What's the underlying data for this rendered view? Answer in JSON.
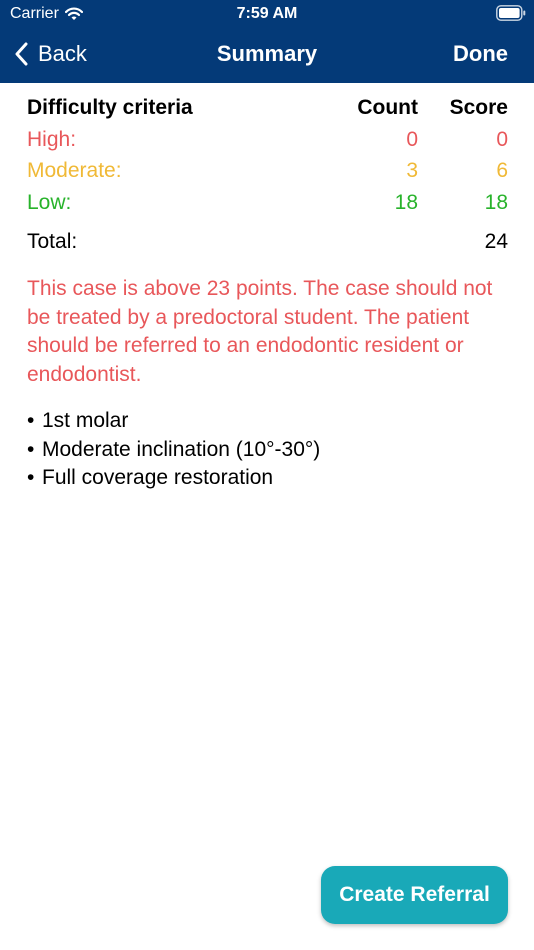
{
  "status_bar": {
    "carrier": "Carrier",
    "time": "7:59 AM"
  },
  "nav": {
    "back_label": "Back",
    "title": "Summary",
    "done_label": "Done"
  },
  "table": {
    "headers": {
      "criteria": "Difficulty criteria",
      "count": "Count",
      "score": "Score"
    },
    "rows": [
      {
        "label": "High:",
        "count": "0",
        "score": "0",
        "color": "#e8575a"
      },
      {
        "label": "Moderate:",
        "count": "3",
        "score": "6",
        "color": "#f0b936"
      },
      {
        "label": "Low:",
        "count": "18",
        "score": "18",
        "color": "#28b32b"
      }
    ],
    "total": {
      "label": "Total:",
      "score": "24"
    }
  },
  "warning": "This case is above 23 points. The case should not be treated by a predoctoral student. The patient should be referred to an endodontic resident or endodontist.",
  "factors": [
    "1st molar",
    "Moderate inclination (10°-30°)",
    "Full coverage restoration"
  ],
  "cta_label": "Create Referral",
  "colors": {
    "nav_bg": "#043a78",
    "cta_bg": "#19a9b8"
  }
}
